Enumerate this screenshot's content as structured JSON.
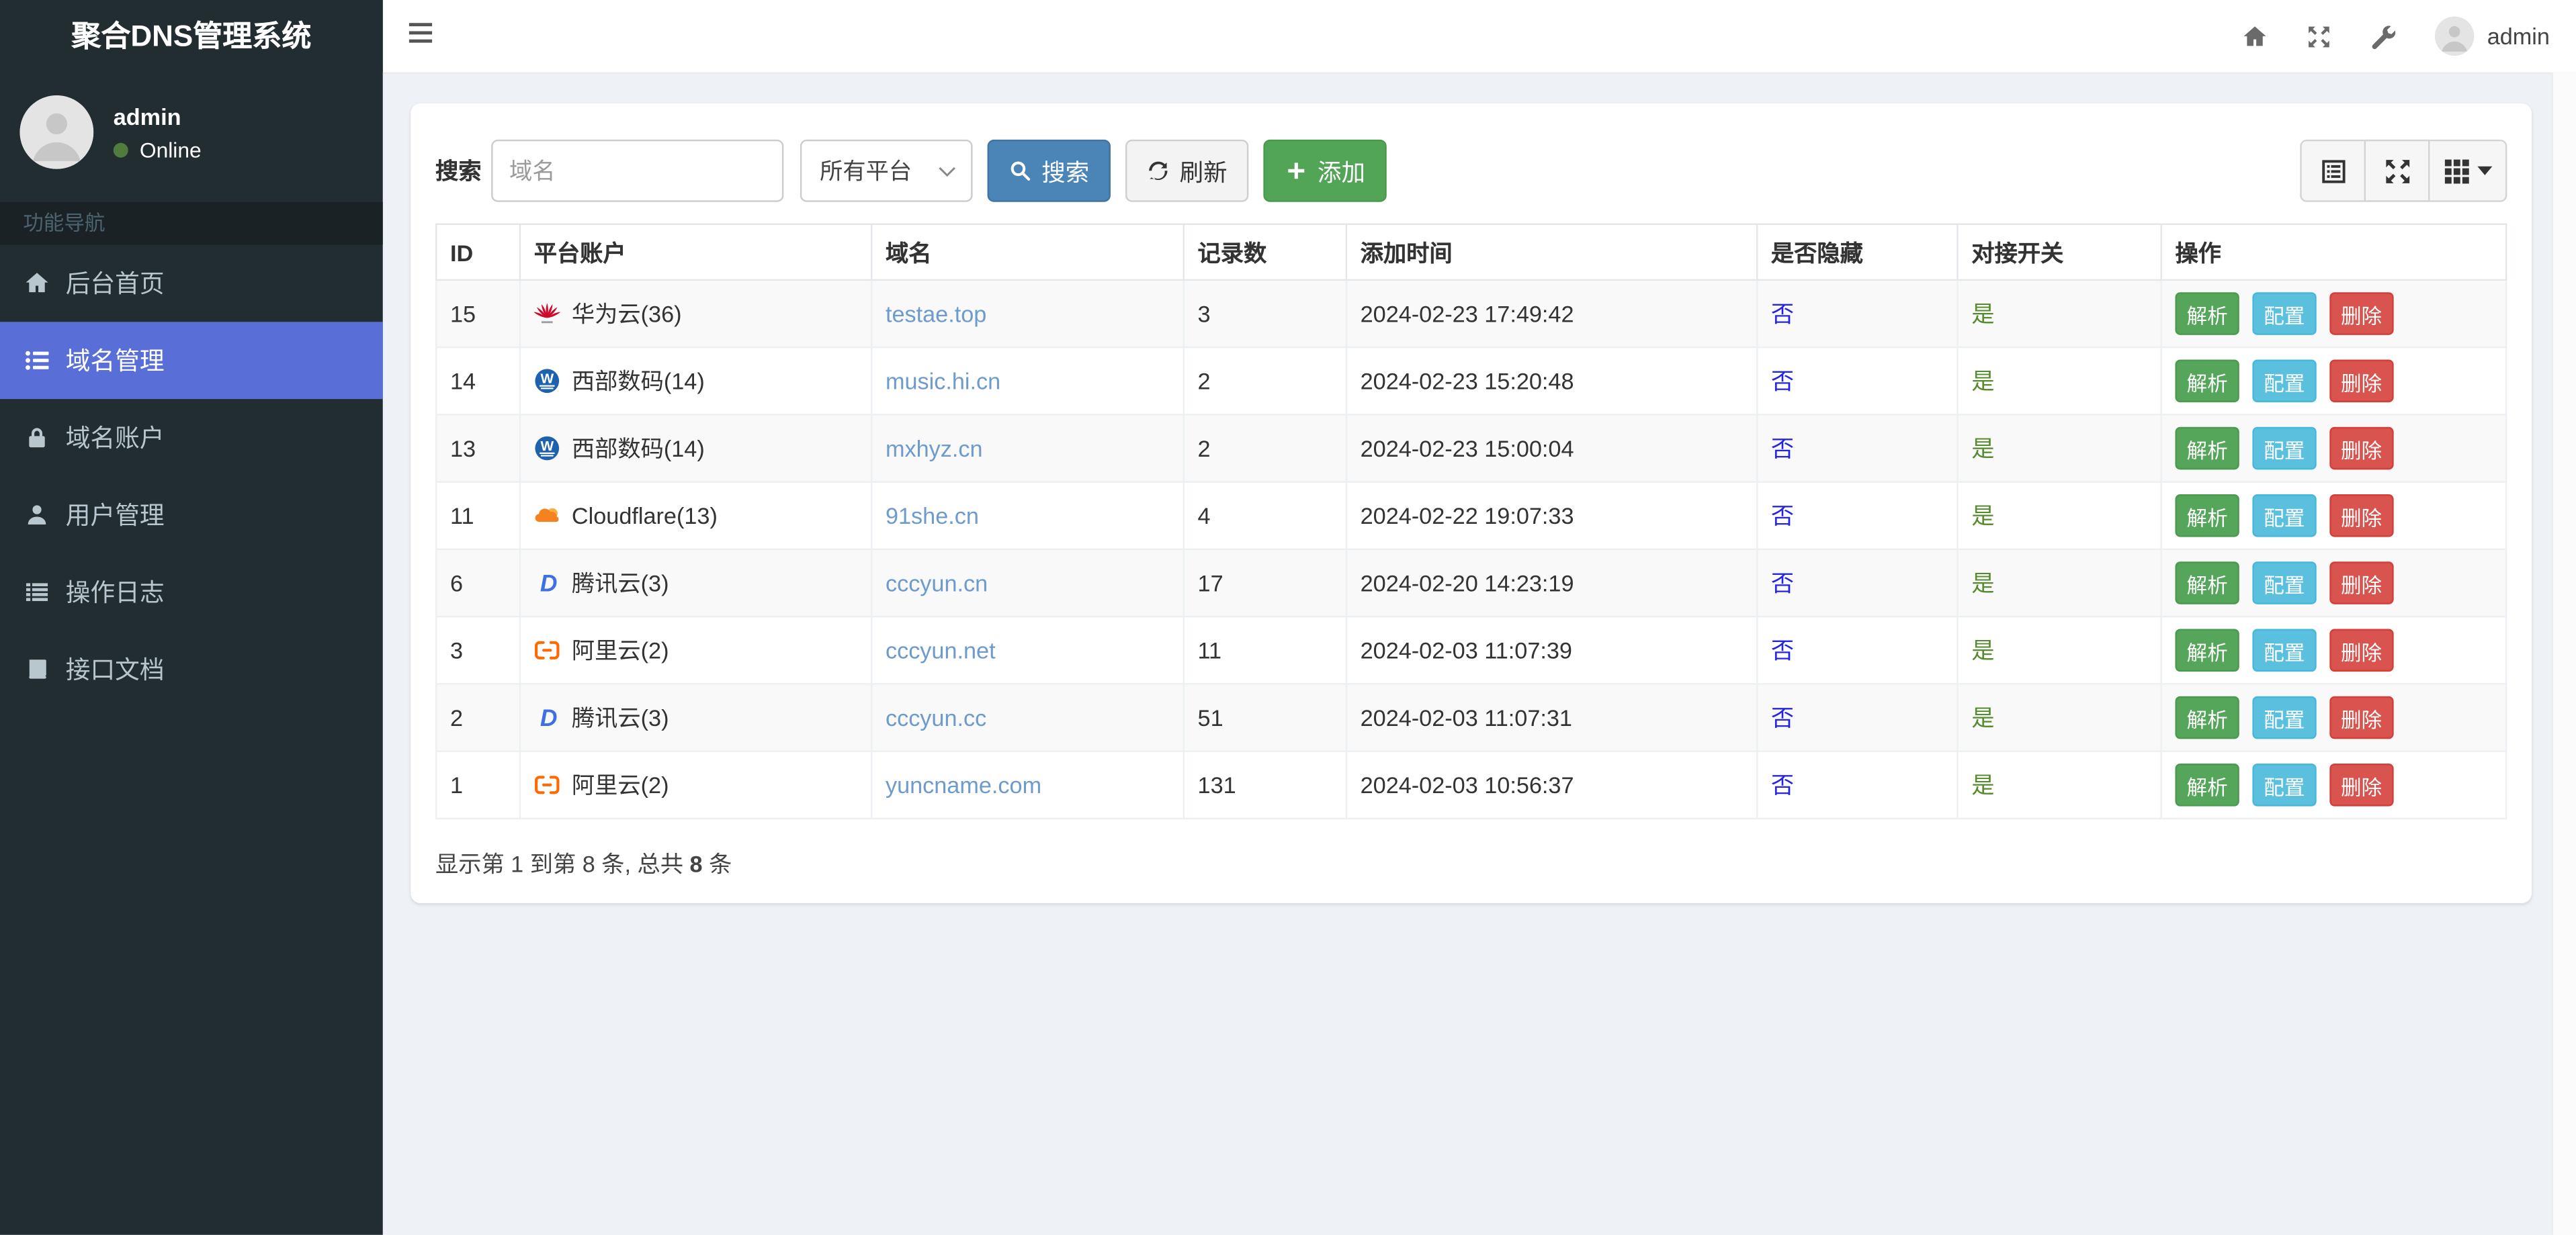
{
  "app": {
    "title": "聚合DNS管理系统"
  },
  "sidebar": {
    "user": {
      "name": "admin",
      "status": "Online"
    },
    "section_label": "功能导航",
    "items": [
      {
        "key": "dashboard",
        "label": "后台首页",
        "icon": "home-icon",
        "active": false
      },
      {
        "key": "domains",
        "label": "域名管理",
        "icon": "list-icon",
        "active": true
      },
      {
        "key": "accounts",
        "label": "域名账户",
        "icon": "lock-icon",
        "active": false
      },
      {
        "key": "users",
        "label": "用户管理",
        "icon": "user-icon",
        "active": false
      },
      {
        "key": "logs",
        "label": "操作日志",
        "icon": "log-icon",
        "active": false
      },
      {
        "key": "api-docs",
        "label": "接口文档",
        "icon": "book-icon",
        "active": false
      }
    ]
  },
  "topbar": {
    "icons": [
      "home-icon",
      "fullscreen-icon",
      "wrench-icon"
    ],
    "user": "admin"
  },
  "toolbar": {
    "search_label": "搜索",
    "domain_placeholder": "域名",
    "platform_select": "所有平台",
    "search_button": "搜索",
    "refresh_button": "刷新",
    "add_button": "添加",
    "view_buttons": [
      {
        "icon": "detail-view-icon",
        "caret": false
      },
      {
        "icon": "fullscreen-icon",
        "caret": false
      },
      {
        "icon": "columns-icon",
        "caret": true
      }
    ]
  },
  "table": {
    "columns": [
      "ID",
      "平台账户",
      "域名",
      "记录数",
      "添加时间",
      "是否隐藏",
      "对接开关",
      "操作"
    ],
    "action_labels": {
      "resolve": "解析",
      "config": "配置",
      "delete": "删除"
    },
    "rows": [
      {
        "id": "15",
        "platform": "华为云(36)",
        "platform_icon": "huawei-icon",
        "domain": "testae.top",
        "records": "3",
        "added_time": "2024-02-23 17:49:42",
        "hidden": "否",
        "switch": "是"
      },
      {
        "id": "14",
        "platform": "西部数码(14)",
        "platform_icon": "west-icon",
        "domain": "music.hi.cn",
        "records": "2",
        "added_time": "2024-02-23 15:20:48",
        "hidden": "否",
        "switch": "是"
      },
      {
        "id": "13",
        "platform": "西部数码(14)",
        "platform_icon": "west-icon",
        "domain": "mxhyz.cn",
        "records": "2",
        "added_time": "2024-02-23 15:00:04",
        "hidden": "否",
        "switch": "是"
      },
      {
        "id": "11",
        "platform": "Cloudflare(13)",
        "platform_icon": "cloudflare-icon",
        "domain": "91she.cn",
        "records": "4",
        "added_time": "2024-02-22 19:07:33",
        "hidden": "否",
        "switch": "是"
      },
      {
        "id": "6",
        "platform": "腾讯云(3)",
        "platform_icon": "dnspod-icon",
        "domain": "cccyun.cn",
        "records": "17",
        "added_time": "2024-02-20 14:23:19",
        "hidden": "否",
        "switch": "是"
      },
      {
        "id": "3",
        "platform": "阿里云(2)",
        "platform_icon": "aliyun-icon",
        "domain": "cccyun.net",
        "records": "11",
        "added_time": "2024-02-03 11:07:39",
        "hidden": "否",
        "switch": "是"
      },
      {
        "id": "2",
        "platform": "腾讯云(3)",
        "platform_icon": "dnspod-icon",
        "domain": "cccyun.cc",
        "records": "51",
        "added_time": "2024-02-03 11:07:31",
        "hidden": "否",
        "switch": "是"
      },
      {
        "id": "1",
        "platform": "阿里云(2)",
        "platform_icon": "aliyun-icon",
        "domain": "yuncname.com",
        "records": "131",
        "added_time": "2024-02-03 10:56:37",
        "hidden": "否",
        "switch": "是"
      }
    ]
  },
  "pagination": {
    "prefix": "显示第 1 到第 8 条, 总共 ",
    "bold": "8",
    "suffix": " 条"
  },
  "colors": {
    "sidebar_bg": "#222d32",
    "sidebar_active": "#5a6ed8",
    "primary": "#4b84b6",
    "success": "#52a556",
    "info": "#5bc0de",
    "danger": "#d9534f",
    "domain_link": "#6d9bce",
    "hidden_link": "#2525e0",
    "switch_on": "#568b2d",
    "content_bg": "#eef1f6"
  }
}
